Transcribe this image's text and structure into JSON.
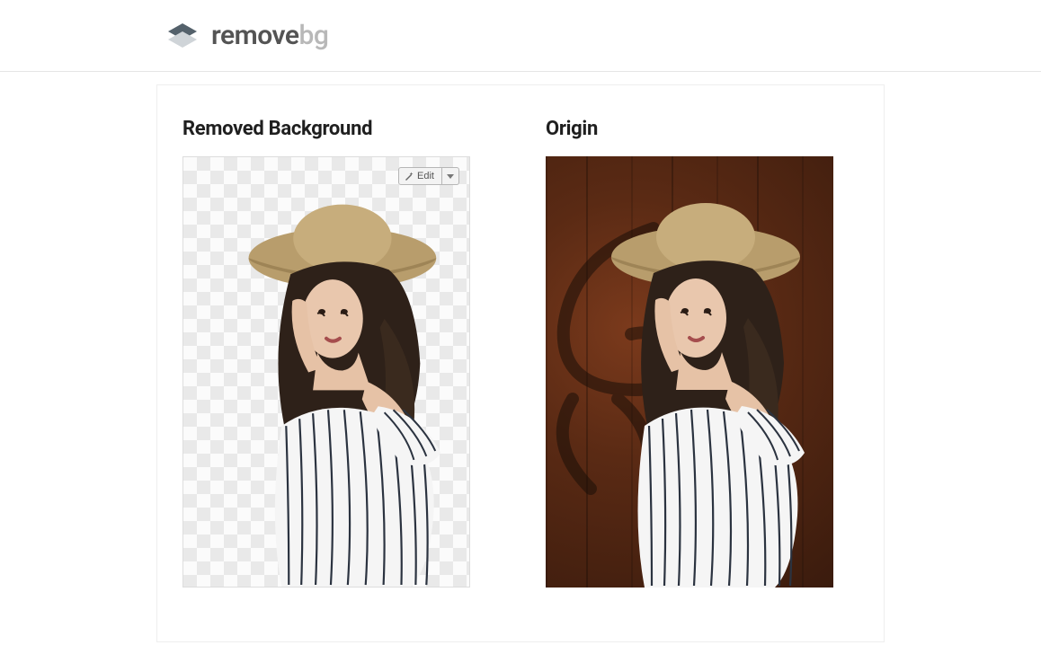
{
  "brand": {
    "part1": "remove",
    "part2": "bg"
  },
  "panels": {
    "left": {
      "title": "Removed Background",
      "edit_label": "Edit"
    },
    "right": {
      "title": "Origin"
    }
  }
}
